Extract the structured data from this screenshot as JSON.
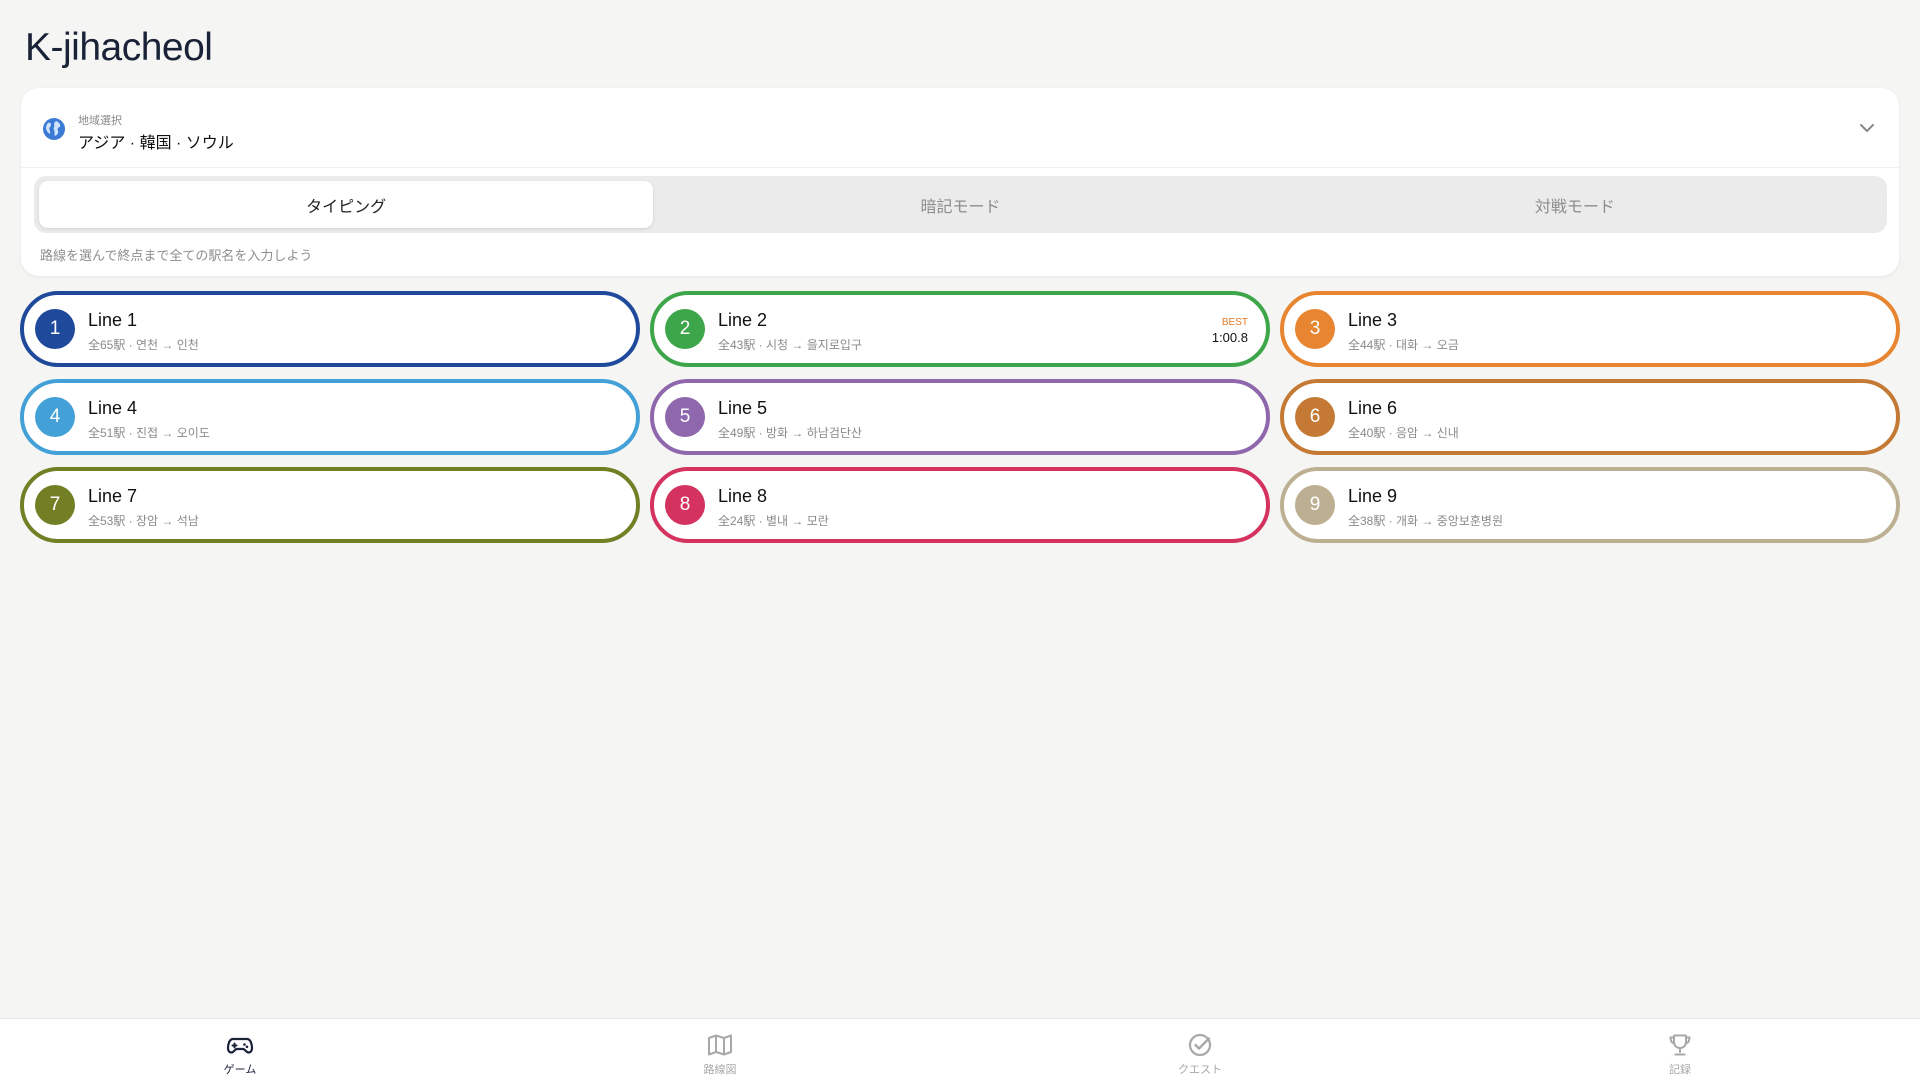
{
  "app": {
    "title": "K-jihacheol"
  },
  "region": {
    "caption": "地域選択",
    "value": "アジア · 韓国 · ソウル",
    "icon": "globe-icon",
    "toggle_icon": "chevron-down-icon"
  },
  "modes": {
    "tabs": [
      {
        "label": "タイピング",
        "active": true
      },
      {
        "label": "暗記モード",
        "active": false
      },
      {
        "label": "対戦モード",
        "active": false
      }
    ],
    "hint": "路線を選んで終点まで全ての駅名を入力しよう"
  },
  "lines": [
    {
      "number": "1",
      "name": "Line 1",
      "detail": "全65駅 · 연천 → 인천",
      "color": "#1f4a9b"
    },
    {
      "number": "2",
      "name": "Line 2",
      "detail": "全43駅 · 시청 → 을지로입구",
      "color": "#3ea64a",
      "best_label": "BEST",
      "best_time": "1:00.8"
    },
    {
      "number": "3",
      "name": "Line 3",
      "detail": "全44駅 · 대화 → 오금",
      "color": "#e88530"
    },
    {
      "number": "4",
      "name": "Line 4",
      "detail": "全51駅 · 진접 → 오이도",
      "color": "#44a1d8"
    },
    {
      "number": "5",
      "name": "Line 5",
      "detail": "全49駅 · 방화 → 하남검단산",
      "color": "#8f67ad"
    },
    {
      "number": "6",
      "name": "Line 6",
      "detail": "全40駅 · 응암 → 신내",
      "color": "#c47a34"
    },
    {
      "number": "7",
      "name": "Line 7",
      "detail": "全53駅 · 장암 → 석남",
      "color": "#737f25"
    },
    {
      "number": "8",
      "name": "Line 8",
      "detail": "全24駅 · 별내 → 모란",
      "color": "#d4325f"
    },
    {
      "number": "9",
      "name": "Line 9",
      "detail": "全38駅 · 개화 → 중앙보훈병원",
      "color": "#bdb092"
    }
  ],
  "nav": {
    "items": [
      {
        "label": "ゲーム",
        "icon": "gamepad-icon",
        "active": true
      },
      {
        "label": "路線図",
        "icon": "map-icon",
        "active": false
      },
      {
        "label": "クエスト",
        "icon": "check-circle-icon",
        "active": false
      },
      {
        "label": "記録",
        "icon": "trophy-icon",
        "active": false
      }
    ]
  }
}
